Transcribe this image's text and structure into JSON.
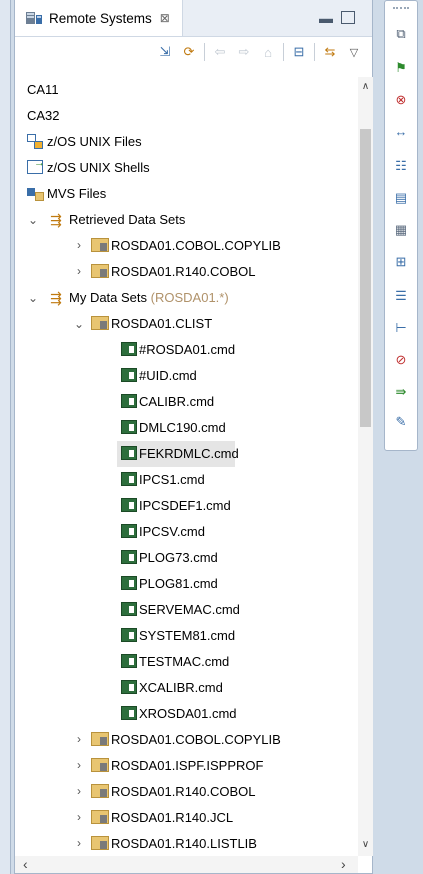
{
  "view": {
    "title": "Remote Systems",
    "close_glyph": "⊠"
  },
  "toolbar": {
    "icons": [
      "new-connection-icon",
      "refresh-icon",
      "back-icon",
      "forward-icon",
      "home-icon",
      "collapse-all-icon",
      "link-with-editor-icon",
      "view-menu-icon"
    ]
  },
  "tree": {
    "rows": [
      {
        "label": "CA11"
      },
      {
        "label": "CA32"
      },
      {
        "label": "z/OS UNIX Files"
      },
      {
        "label": "z/OS UNIX Shells"
      },
      {
        "label": "MVS Files"
      },
      {
        "label": "Retrieved Data Sets"
      },
      {
        "label": "ROSDA01.COBOL.COPYLIB"
      },
      {
        "label": "ROSDA01.R140.COBOL"
      },
      {
        "label": "My Data Sets",
        "suffix": "(ROSDA01.*)"
      },
      {
        "label": "ROSDA01.CLIST"
      },
      {
        "label": "#ROSDA01.cmd"
      },
      {
        "label": "#UID.cmd"
      },
      {
        "label": "CALIBR.cmd"
      },
      {
        "label": "DMLC190.cmd"
      },
      {
        "label": "FEKRDMLC.cmd"
      },
      {
        "label": "IPCS1.cmd"
      },
      {
        "label": "IPCSDEF1.cmd"
      },
      {
        "label": "IPCSV.cmd"
      },
      {
        "label": "PLOG73.cmd"
      },
      {
        "label": "PLOG81.cmd"
      },
      {
        "label": "SERVEMAC.cmd"
      },
      {
        "label": "SYSTEM81.cmd"
      },
      {
        "label": "TESTMAC.cmd"
      },
      {
        "label": "XCALIBR.cmd"
      },
      {
        "label": "XROSDA01.cmd"
      },
      {
        "label": "ROSDA01.COBOL.COPYLIB"
      },
      {
        "label": "ROSDA01.ISPF.ISPPROF"
      },
      {
        "label": "ROSDA01.R140.COBOL"
      },
      {
        "label": "ROSDA01.R140.JCL"
      },
      {
        "label": "ROSDA01.R140.LISTLIB"
      }
    ]
  },
  "colors": {
    "accent": "#3a6ea8",
    "filter_text": "#b0926a",
    "selection": "#e5e5e5",
    "file_icon": "#2d6e3c",
    "folder_icon": "#e8c571"
  },
  "trim": {
    "icons": [
      "restore-icon",
      "flag-icon",
      "error-log-icon",
      "compare-icon",
      "outline-icon",
      "properties-icon",
      "remote-systems-icon",
      "team-icon",
      "table-icon",
      "hierarchy-icon",
      "problems-icon",
      "console-icon",
      "task-icon"
    ]
  }
}
